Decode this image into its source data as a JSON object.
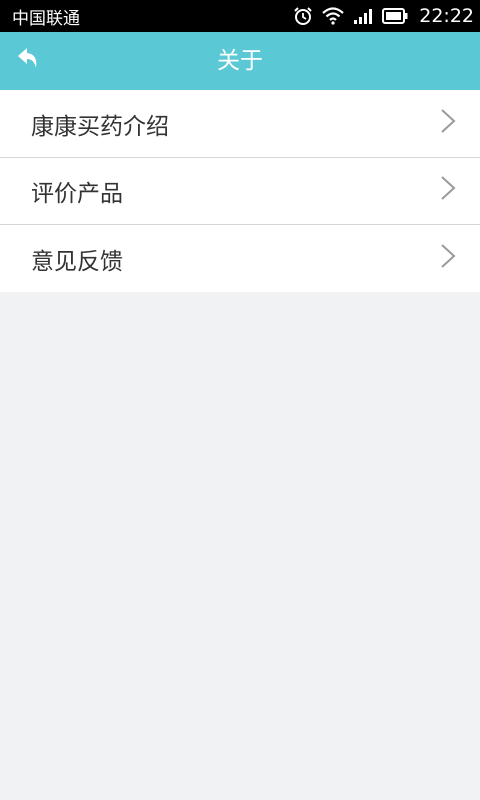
{
  "status_bar": {
    "carrier": "中国联通",
    "time": "22:22",
    "icons": [
      "alarm-icon",
      "wifi-icon",
      "signal-icon",
      "battery-icon"
    ]
  },
  "app_bar": {
    "title": "关于",
    "back_icon": "back-arrow-icon"
  },
  "menu": {
    "items": [
      {
        "label": "康康买药介绍",
        "icon": "chevron-right-icon"
      },
      {
        "label": "评价产品",
        "icon": "chevron-right-icon"
      },
      {
        "label": "意见反馈",
        "icon": "chevron-right-icon"
      }
    ]
  },
  "colors": {
    "status_bar": "#000000",
    "app_bar": "#5bc8d5",
    "background": "#f1f2f4",
    "list_background": "#ffffff",
    "divider": "#d6d6d6",
    "text": "#333333",
    "chevron": "#9a9a9a"
  }
}
